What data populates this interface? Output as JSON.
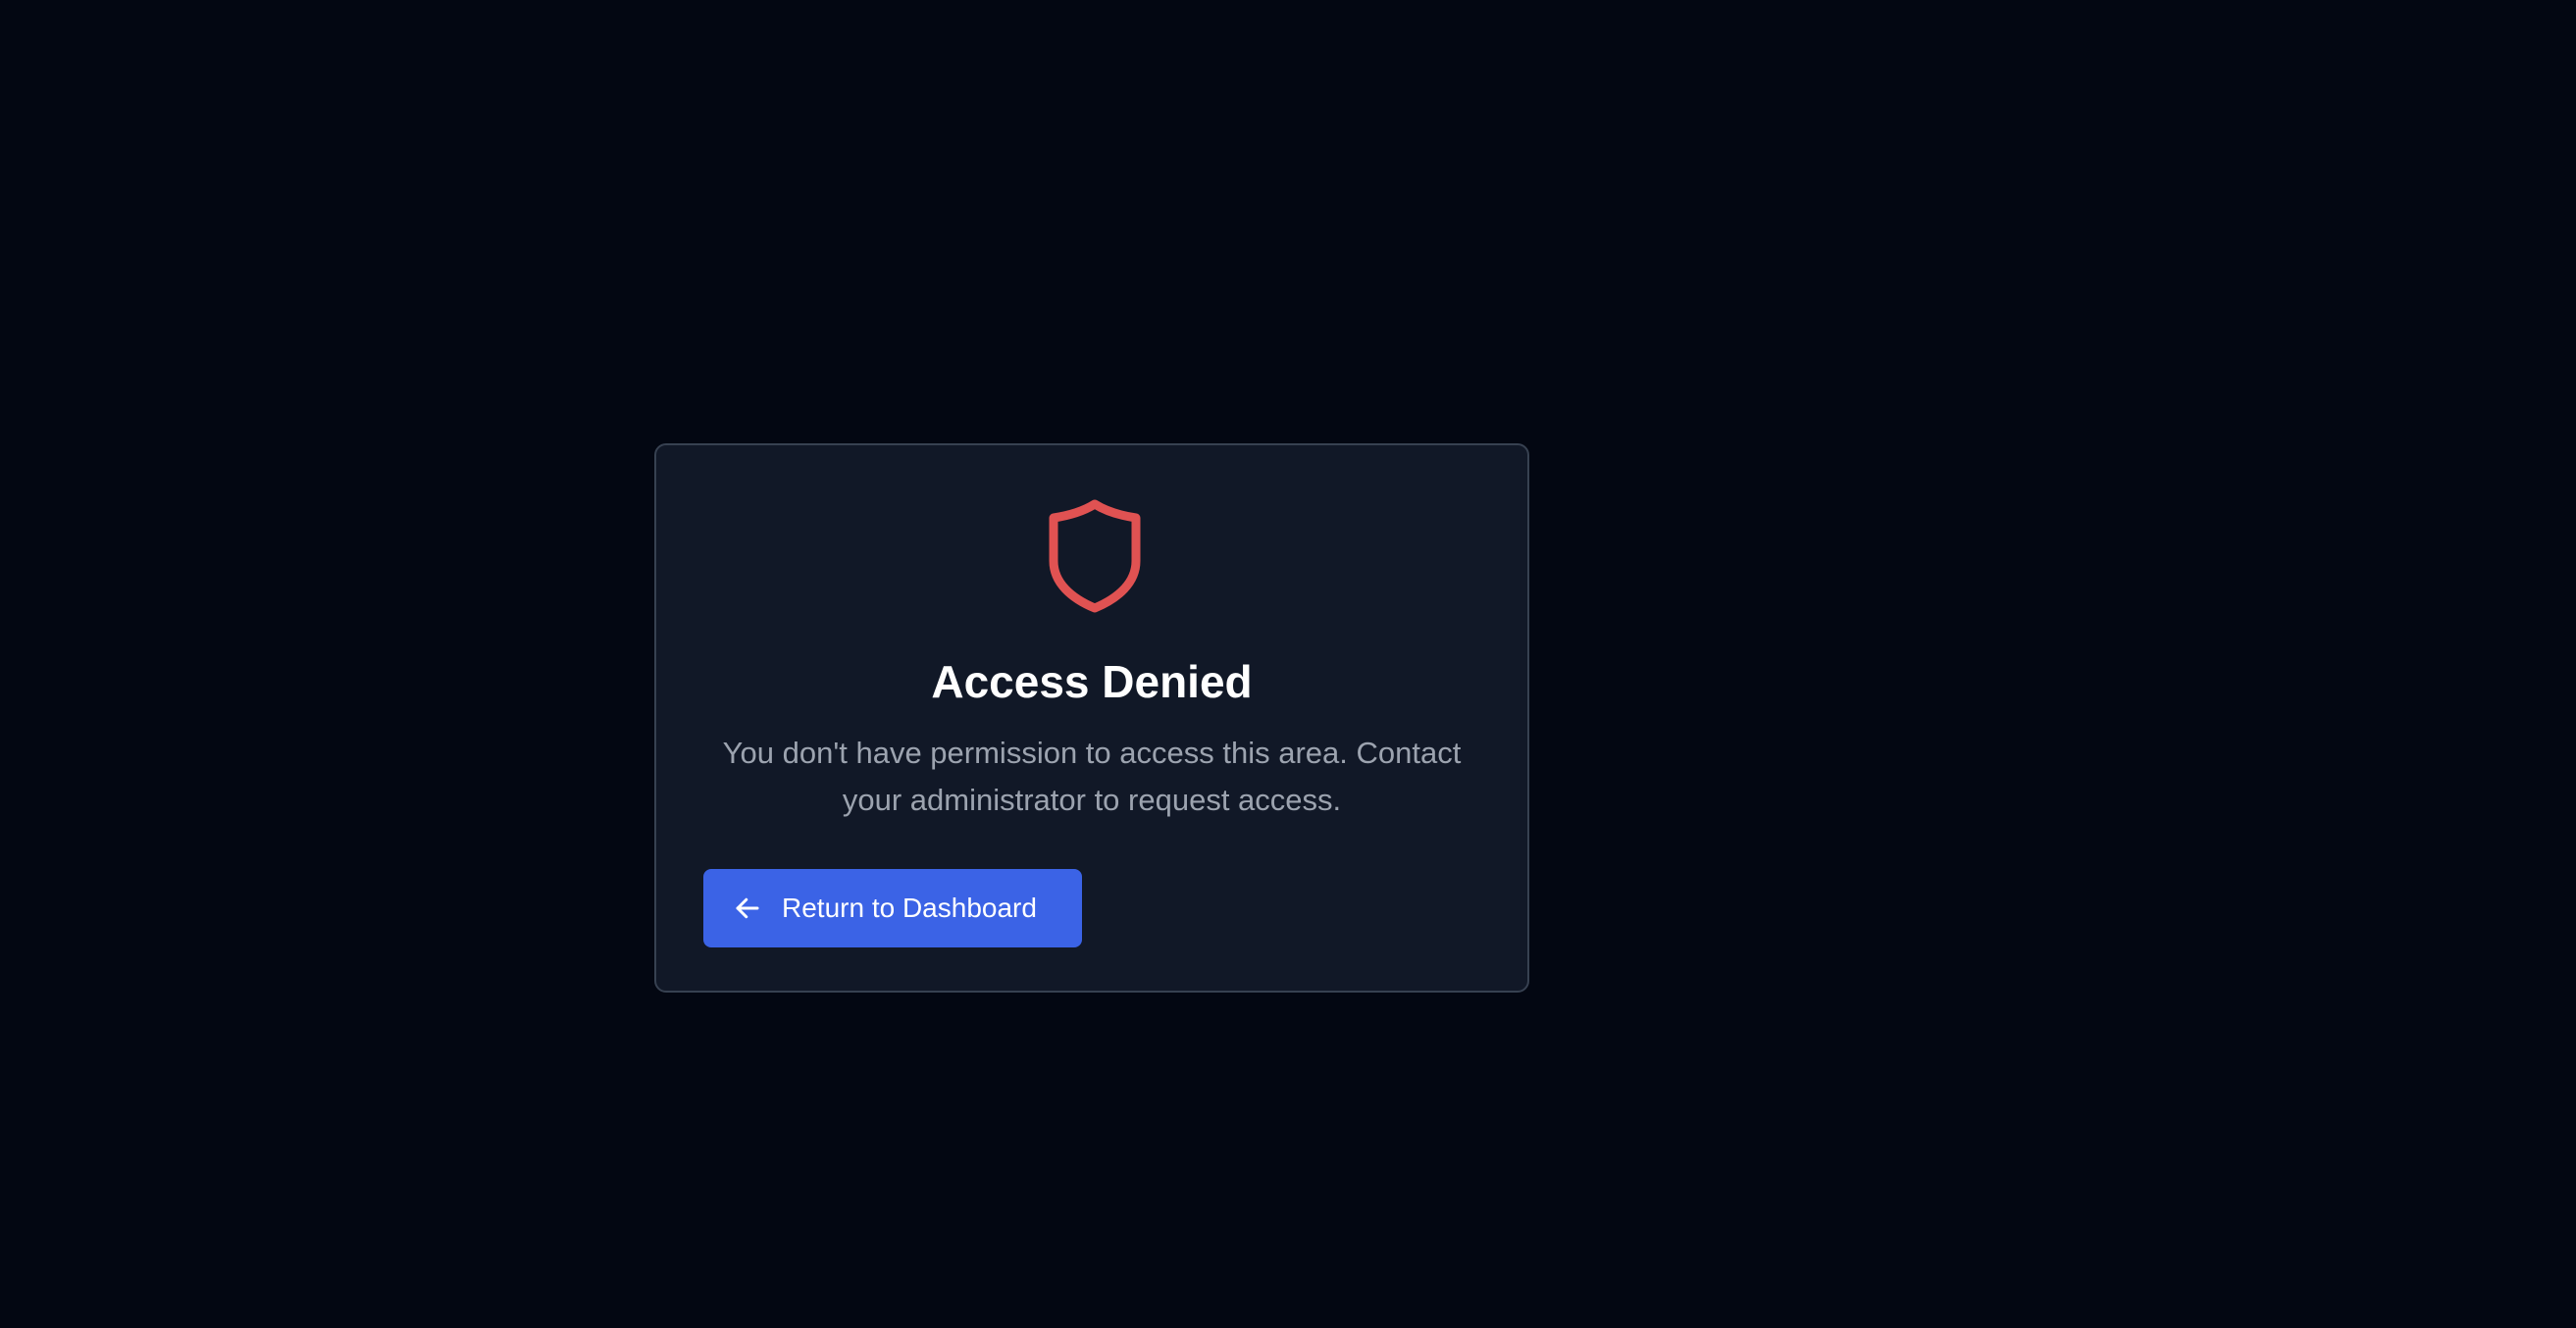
{
  "card": {
    "icon": "shield-icon",
    "title": "Access Denied",
    "message": "You don't have permission to access this area. Contact your administrator to request access.",
    "button": {
      "icon": "arrow-left-icon",
      "label": "Return to Dashboard"
    }
  },
  "colors": {
    "background": "#030712",
    "card": "#111827",
    "card_border": "#374151",
    "accent_danger": "#e05252",
    "button": "#3b63e6",
    "title_text": "#ffffff",
    "message_text": "#9ca3af"
  }
}
